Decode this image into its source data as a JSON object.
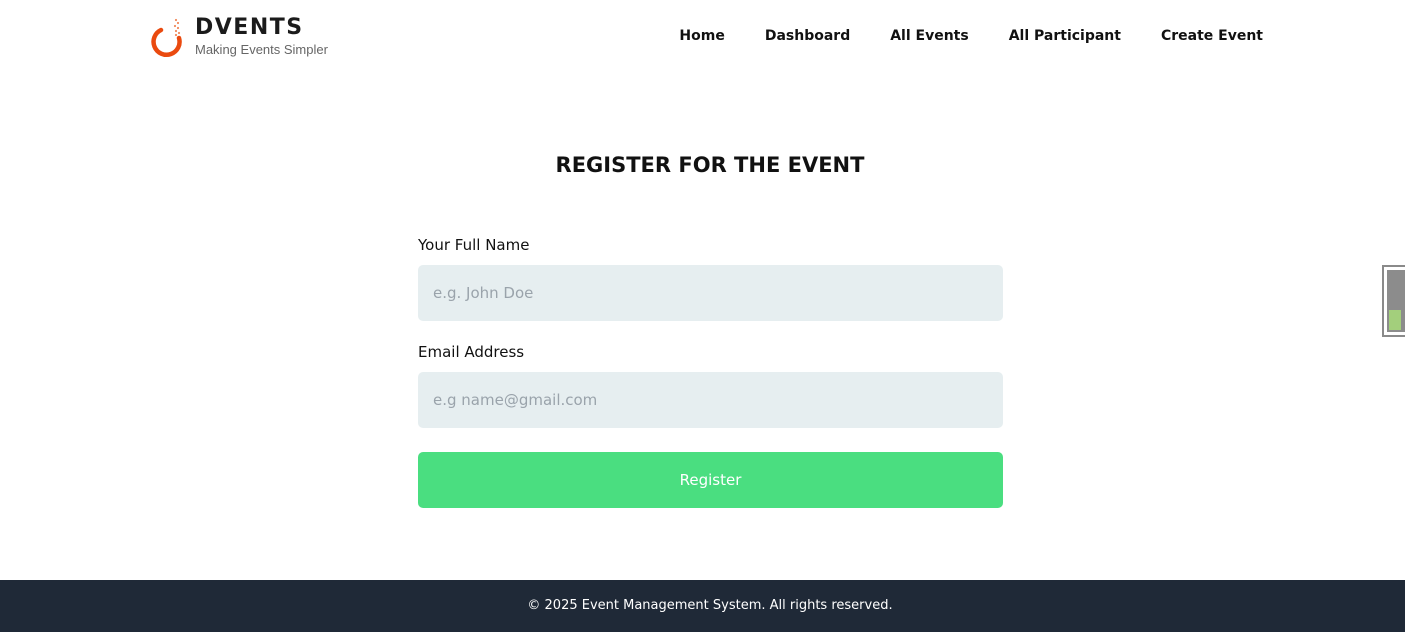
{
  "brand": {
    "name": "DVENTS",
    "tagline": "Making Events Simpler",
    "accent_color": "#ea4a0f",
    "icon": "dvents-logo-icon"
  },
  "nav": {
    "items": [
      {
        "label": "Home"
      },
      {
        "label": "Dashboard"
      },
      {
        "label": "All Events"
      },
      {
        "label": "All Participant"
      },
      {
        "label": "Create Event"
      }
    ]
  },
  "page": {
    "title": "REGISTER FOR THE EVENT"
  },
  "form": {
    "name_label": "Your Full Name",
    "name_value": "",
    "name_placeholder": "e.g. John Doe",
    "email_label": "Email Address",
    "email_value": "",
    "email_placeholder": "e.g name@gmail.com",
    "submit_label": "Register",
    "submit_color": "#4ade80",
    "input_background": "#e6eef0"
  },
  "footer": {
    "text": "© 2025 Event Management System. All rights reserved.",
    "background": "#1f2937"
  }
}
